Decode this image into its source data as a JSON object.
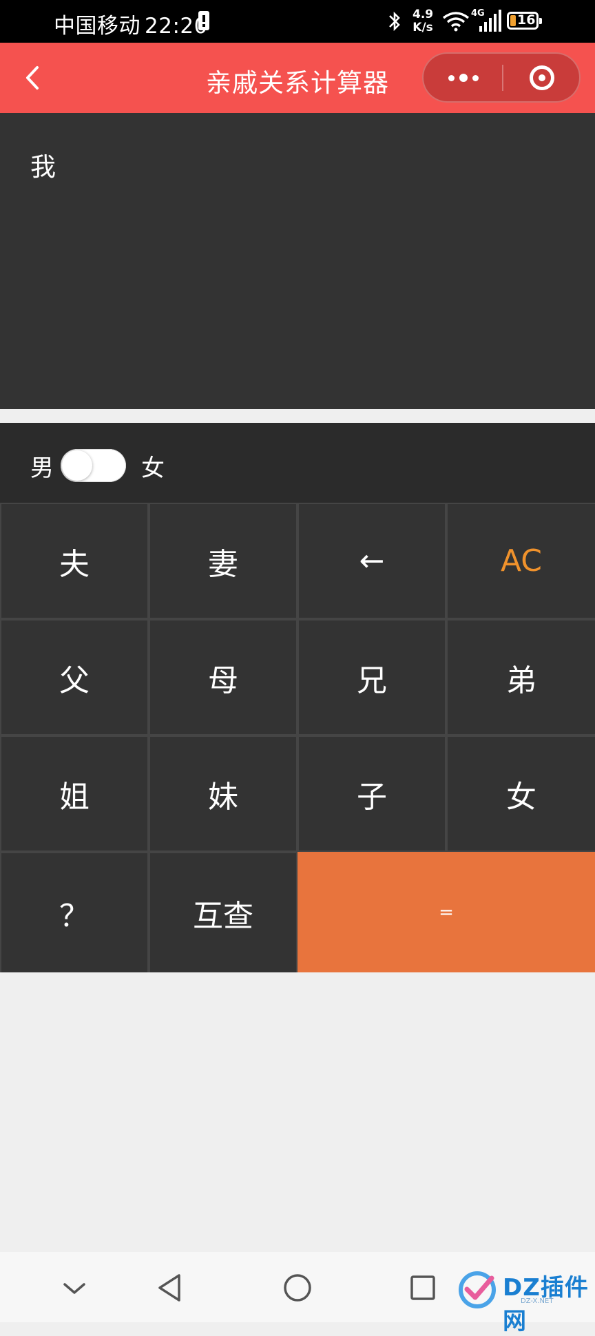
{
  "status_bar": {
    "carrier": "中国移动",
    "time": "22:20",
    "speed_value": "4.9",
    "speed_unit": "K/s",
    "network": "4G",
    "battery": "16"
  },
  "nav": {
    "title": "亲戚关系计算器"
  },
  "display": {
    "text": "我"
  },
  "gender": {
    "male_label": "男",
    "female_label": "女",
    "selected": "男"
  },
  "keypad": {
    "keys": [
      "夫",
      "妻",
      "←",
      "AC",
      "父",
      "母",
      "兄",
      "弟",
      "姐",
      "妹",
      "子",
      "女",
      "？",
      "互查",
      "="
    ]
  },
  "colors": {
    "nav_bar": "#f5524f",
    "equals_key": "#e8743d",
    "ac_key_text": "#f0922c"
  },
  "watermark": {
    "text": "DZ插件网",
    "sub": "DZ-X.NET"
  }
}
